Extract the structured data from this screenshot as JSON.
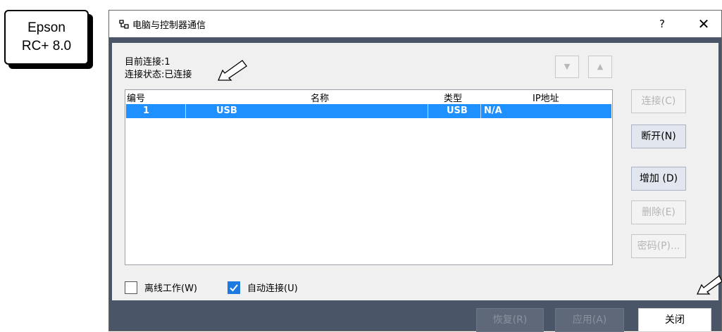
{
  "brand": {
    "line1": "Epson",
    "line2": "RC+ 8.0"
  },
  "dialog": {
    "title": "电脑与控制器通信",
    "help_label": "?",
    "close_label": "✕"
  },
  "status": {
    "current_connection": "目前连接:1",
    "connection_state": "连接状态:已连接"
  },
  "nav": {
    "down": "▼",
    "up": "▲"
  },
  "table": {
    "headers": {
      "number": "编号",
      "name": "名称",
      "type": "类型",
      "ip": "IP地址"
    },
    "rows": [
      {
        "number": "1",
        "name": "USB",
        "type": "USB",
        "ip": "N/A"
      }
    ]
  },
  "buttons": {
    "connect": "连接(C)",
    "disconnect": "断开(N)",
    "add": "增加 (D)",
    "delete": "删除(E)",
    "password": "密码(P)..."
  },
  "checkboxes": {
    "offline": {
      "label": "离线工作(W)",
      "checked": false
    },
    "auto_connect": {
      "label": "自动连接(U)",
      "checked": true
    }
  },
  "footer": {
    "restore": "恢复(R)",
    "apply": "应用(A)",
    "close": "关闭"
  }
}
